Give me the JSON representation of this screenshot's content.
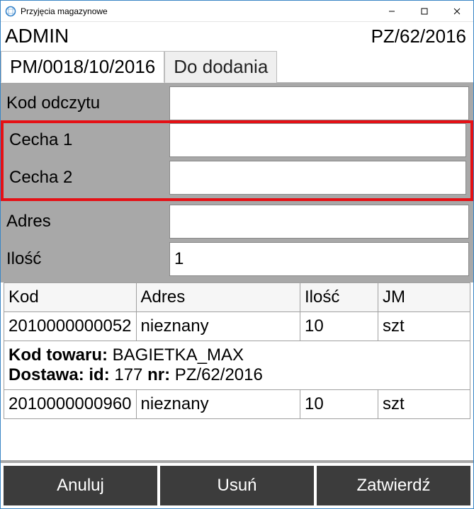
{
  "window": {
    "title": "Przyjęcia magazynowe"
  },
  "header": {
    "user": "ADMIN",
    "doc_number": "PZ/62/2016"
  },
  "tabs": {
    "active": "PM/0018/10/2016",
    "inactive": "Do dodania"
  },
  "form": {
    "kod_odczytu_label": "Kod odczytu",
    "kod_odczytu_value": "",
    "cecha1_label": "Cecha 1",
    "cecha1_value": "",
    "cecha2_label": "Cecha 2",
    "cecha2_value": "",
    "adres_label": "Adres",
    "adres_value": "",
    "ilosc_label": "Ilość",
    "ilosc_value": "1"
  },
  "table": {
    "headers": {
      "kod": "Kod",
      "adres": "Adres",
      "ilosc": "Ilość",
      "jm": "JM"
    },
    "rows": [
      {
        "kod": "2010000000052",
        "adres": "nieznany",
        "ilosc": "10",
        "jm": "szt"
      },
      {
        "kod": "2010000000960",
        "adres": "nieznany",
        "ilosc": "10",
        "jm": "szt"
      }
    ],
    "meta": {
      "kod_towaru_label": "Kod towaru:",
      "kod_towaru_value": "BAGIETKA_MAX",
      "dostawa_label": "Dostawa:",
      "id_label": "id:",
      "id_value": "177",
      "nr_label": "nr:",
      "nr_value": "PZ/62/2016"
    }
  },
  "buttons": {
    "cancel": "Anuluj",
    "delete": "Usuń",
    "confirm": "Zatwierdź"
  }
}
